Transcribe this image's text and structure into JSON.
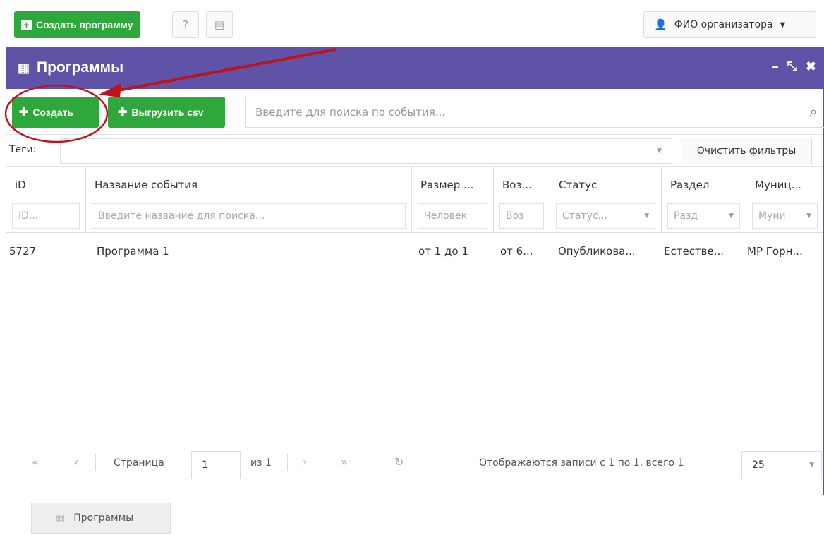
{
  "topbar": {
    "create_program": "Создать программу",
    "user_name": "ФИО организатора"
  },
  "window": {
    "title": "Программы"
  },
  "toolbar": {
    "create_label": "Создать",
    "export_label": "Выгрузить csv",
    "search_placeholder": "Введите для поиска по события..."
  },
  "filters": {
    "tags_label": "Теги:",
    "clear_label": "Очистить фильтры"
  },
  "grid": {
    "columns": [
      {
        "header": "iD",
        "filter": "ID..."
      },
      {
        "header": "Название события",
        "filter": "Введите название для поиска..."
      },
      {
        "header": "Размер ...",
        "filter": "Человек"
      },
      {
        "header": "Воз...",
        "filter": "Воз"
      },
      {
        "header": "Статус",
        "filter": "Статус..."
      },
      {
        "header": "Раздел",
        "filter": "Разд"
      },
      {
        "header": "Муниц...",
        "filter": "Муни"
      }
    ],
    "rows": [
      {
        "id": "5727",
        "name": "Программа 1",
        "size": "от 1 до 1",
        "age": "от 6...",
        "status": "Опубликова...",
        "section": "Естестве...",
        "municipality": "МР Горн..."
      }
    ]
  },
  "pager": {
    "page_label": "Страница",
    "page_value": "1",
    "of_label": "из 1",
    "summary": "Отображаются записи с 1 по 1, всего 1",
    "page_size": "25"
  },
  "taskbar": {
    "programs_label": "Программы"
  },
  "colors": {
    "header": "#5e53a6",
    "green": "#2ea83a",
    "annotation": "#c0121b"
  }
}
